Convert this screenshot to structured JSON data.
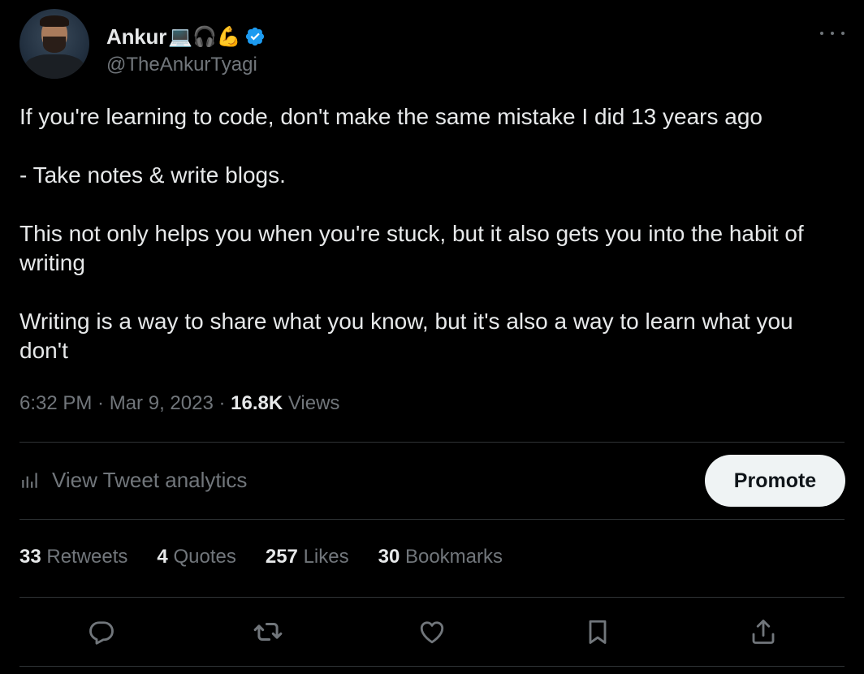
{
  "author": {
    "name": "Ankur",
    "name_emojis": "💻🎧💪",
    "handle": "@TheAnkurTyagi",
    "verified": true
  },
  "tweet": {
    "paragraphs": [
      "If you're learning to code, don't make the same mistake I did 13 years ago",
      "- Take notes & write blogs.",
      "This not only helps you when you're stuck, but it also gets you into the habit of writing",
      "Writing is a way to share what you know, but it's also a way to learn what you don't"
    ],
    "time": "6:32 PM",
    "date": "Mar 9, 2023",
    "views_count": "16.8K",
    "views_label": "Views"
  },
  "analytics": {
    "label": "View Tweet analytics",
    "icon": "bar-chart-icon"
  },
  "promote": {
    "label": "Promote"
  },
  "stats": [
    {
      "count": "33",
      "label": "Retweets"
    },
    {
      "count": "4",
      "label": "Quotes"
    },
    {
      "count": "257",
      "label": "Likes"
    },
    {
      "count": "30",
      "label": "Bookmarks"
    }
  ],
  "actions": [
    "reply-icon",
    "retweet-icon",
    "like-icon",
    "bookmark-icon",
    "share-icon"
  ],
  "colors": {
    "background": "#000000",
    "text": "#e7e9ea",
    "muted": "#71767b",
    "divider": "#2f3336",
    "verified": "#1d9bf0",
    "promote_bg": "#eff3f4"
  }
}
